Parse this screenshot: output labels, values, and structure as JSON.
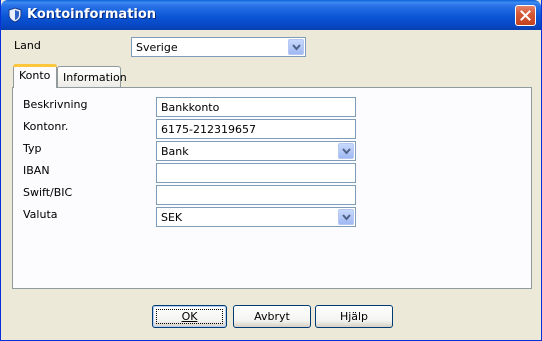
{
  "window": {
    "title": "Kontoinformation"
  },
  "land": {
    "label": "Land",
    "value": "Sverige"
  },
  "tabs": [
    {
      "label": "Konto",
      "active": true
    },
    {
      "label": "Information",
      "active": false
    }
  ],
  "fields": {
    "beskrivning": {
      "label": "Beskrivning",
      "value": "Bankkonto"
    },
    "kontonr": {
      "label": "Kontonr.",
      "value": "6175-212319657"
    },
    "typ": {
      "label": "Typ",
      "value": "Bank"
    },
    "iban": {
      "label": "IBAN",
      "value": ""
    },
    "swift": {
      "label": "Swift/BIC",
      "value": ""
    },
    "valuta": {
      "label": "Valuta",
      "value": "SEK"
    }
  },
  "buttons": {
    "ok": "OK",
    "cancel": "Avbryt",
    "help": "Hjälp"
  },
  "colors": {
    "titlebar": "#0a56d6",
    "window_bg": "#ece9d8",
    "close_button": "#c3411e",
    "active_tab_highlight": "#ffc83c"
  },
  "icons": {
    "title": "app-shield-icon",
    "close": "close-icon",
    "dropdown": "chevron-down-icon"
  }
}
